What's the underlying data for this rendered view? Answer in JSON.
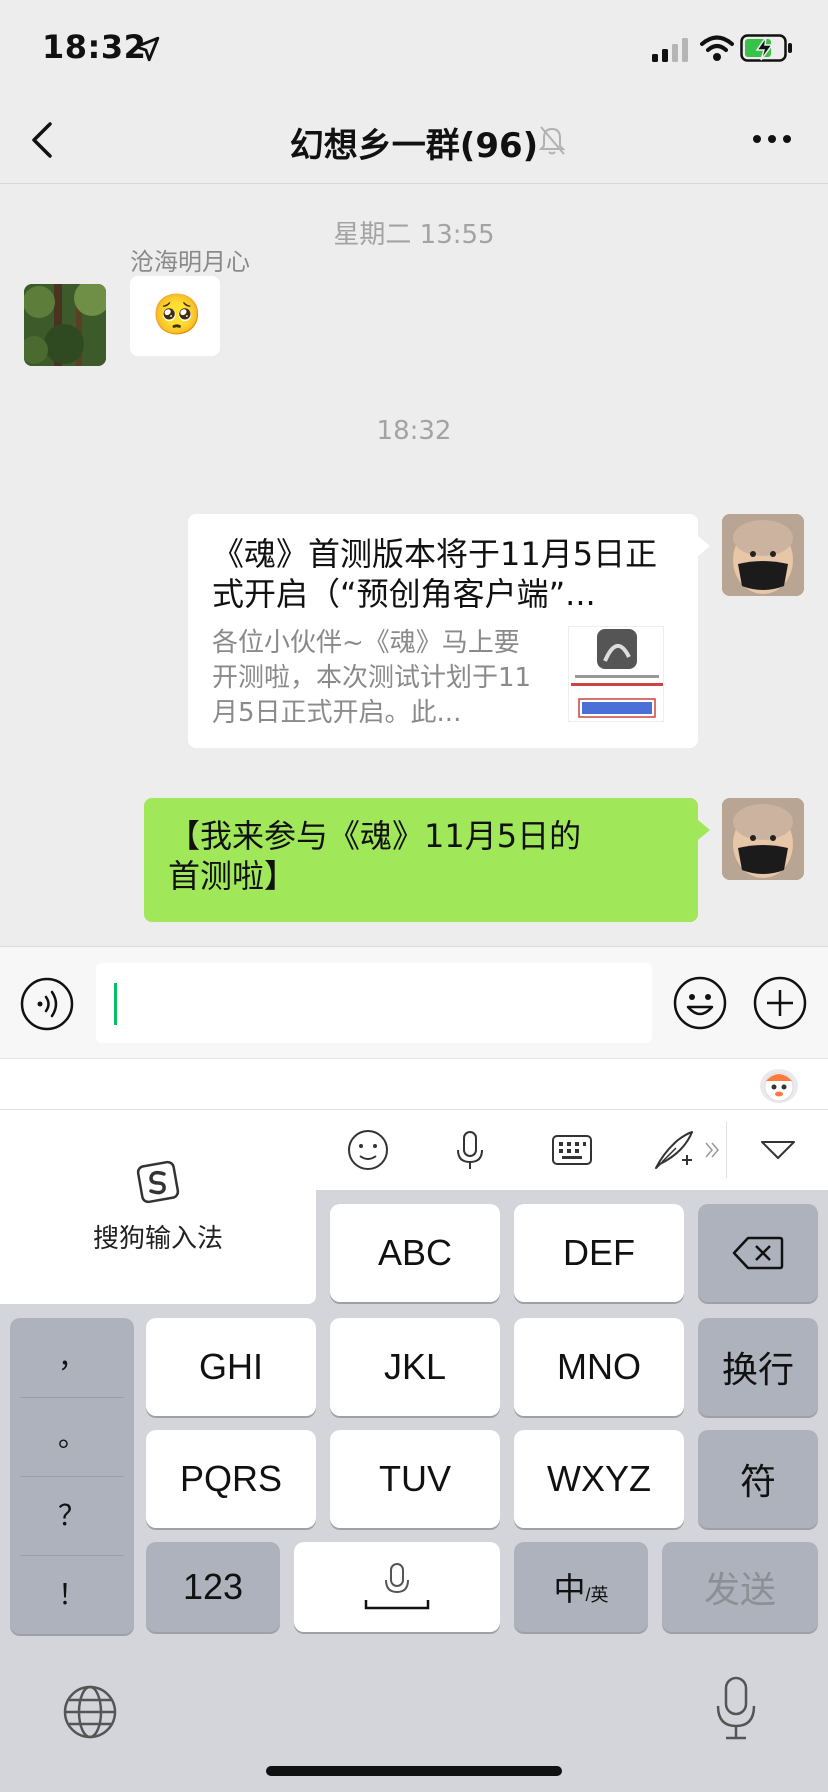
{
  "status_bar": {
    "time": "18:32"
  },
  "header": {
    "title": "幻想乡一群(96)"
  },
  "chat": {
    "timestamp_1": "星期二 13:55",
    "message_1": {
      "sender": "沧海明月心",
      "content": "🥺"
    },
    "timestamp_2": "18:32",
    "message_2": {
      "card_title": "《魂》首测版本将于11月5日正式开启（“预创角客户端”...",
      "card_desc": "各位小伙伴~《魂》马上要开测啦，本次测试计划于11月5日正式开启。此..."
    },
    "message_3": {
      "text": "【我来参与《魂》11月5日的首测啦】"
    }
  },
  "input": {
    "value": ""
  },
  "keyboard": {
    "brand": "搜狗输入法",
    "row1": [
      "ABC",
      "DEF"
    ],
    "row2": [
      "GHI",
      "JKL",
      "MNO",
      "换行"
    ],
    "row3": [
      "PQRS",
      "TUV",
      "WXYZ",
      "符"
    ],
    "row4": {
      "numbers": "123",
      "lang_main": "中",
      "lang_sub": "/英",
      "send": "发送"
    },
    "punctuation": [
      "，",
      "。",
      "？",
      "！"
    ]
  },
  "colors": {
    "chat_background": "#ededed",
    "own_bubble": "#a0e75a",
    "caret": "#07c160",
    "keyboard_background": "#d3d5db"
  }
}
